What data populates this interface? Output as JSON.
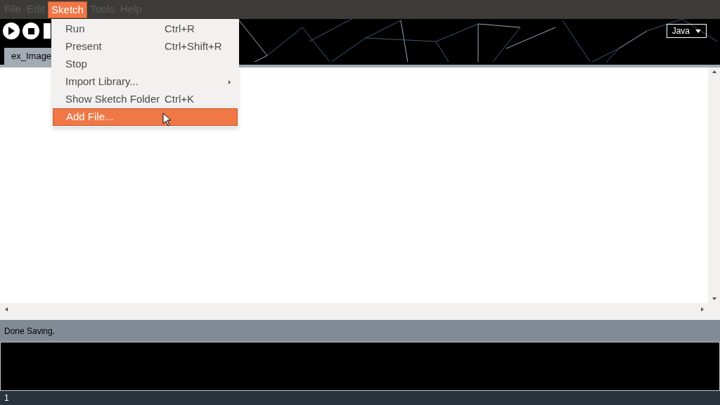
{
  "menu_bar": [
    {
      "label": "File",
      "selected": false
    },
    {
      "label": "Edit",
      "selected": false
    },
    {
      "label": "Sketch",
      "selected": true
    },
    {
      "label": "Tools",
      "selected": false
    },
    {
      "label": "Help",
      "selected": false
    }
  ],
  "menu": {
    "items": [
      {
        "label": "Run",
        "shortcut": "Ctrl+R",
        "submenu": false,
        "selected": false
      },
      {
        "label": "Present",
        "shortcut": "Ctrl+Shift+R",
        "submenu": false,
        "selected": false
      },
      {
        "label": "Stop",
        "submenu": false,
        "selected": false
      },
      {
        "label": "Import Library...",
        "submenu": true,
        "selected": false
      },
      {
        "label": "Show Sketch Folder",
        "shortcut": "Ctrl+K",
        "submenu": false,
        "selected": false
      },
      {
        "label": "Add File...",
        "submenu": false,
        "selected": true
      }
    ]
  },
  "mode": "Java",
  "tabs": [
    {
      "label": "ex_Image",
      "selected": true
    }
  ],
  "status": "Done Saving.",
  "line_number": "1"
}
